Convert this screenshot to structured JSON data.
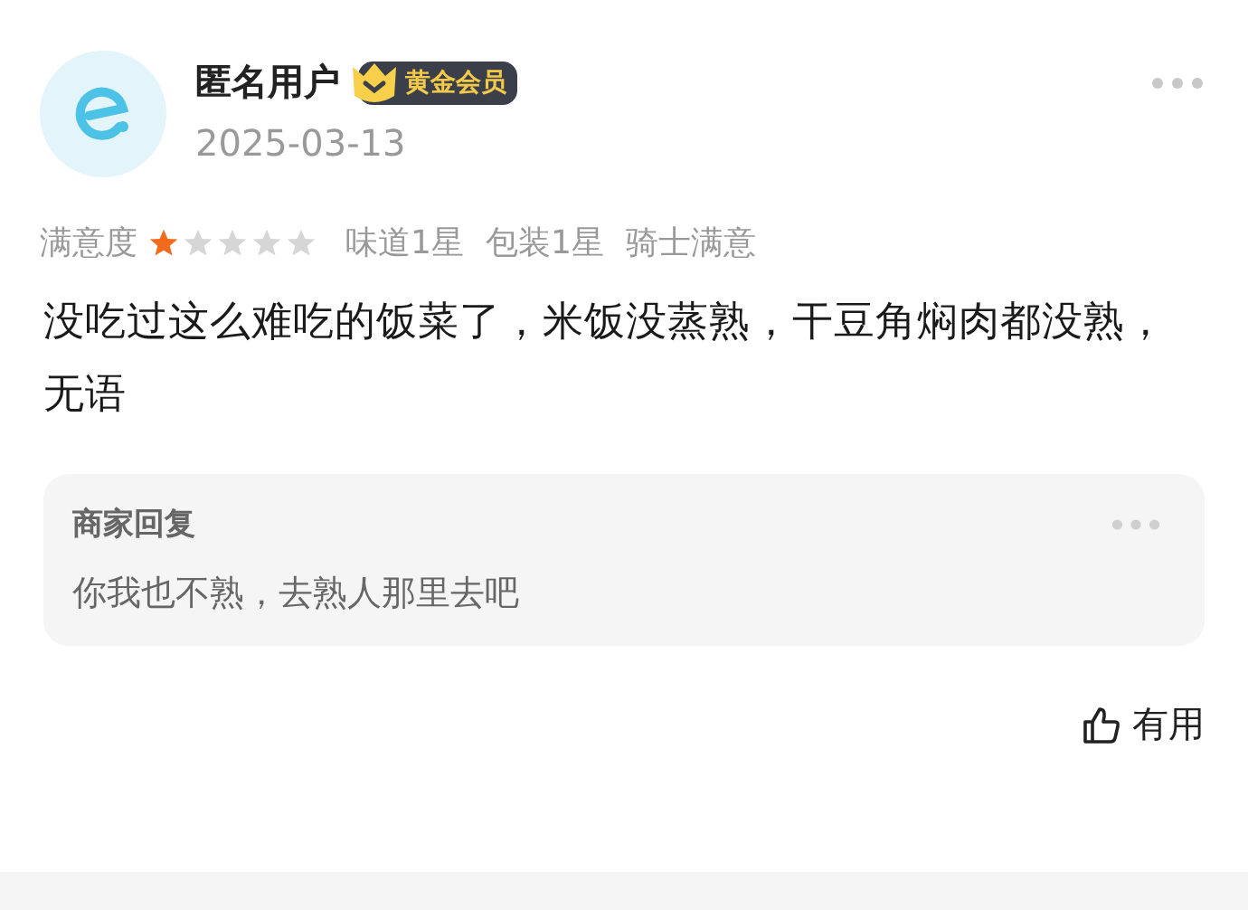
{
  "review": {
    "user_name": "匿名用户",
    "badge": "黄金会员",
    "date": "2025-03-13",
    "rating_label": "满意度",
    "stars": 1,
    "tags": [
      "味道1星",
      "包装1星",
      "骑士满意"
    ],
    "text": "没吃过这么难吃的饭菜了，米饭没蒸熟，干豆角焖肉都没熟，无语"
  },
  "reply": {
    "title": "商家回复",
    "text": "你我也不熟，去熟人那里去吧"
  },
  "helpful": {
    "label": "有用"
  }
}
